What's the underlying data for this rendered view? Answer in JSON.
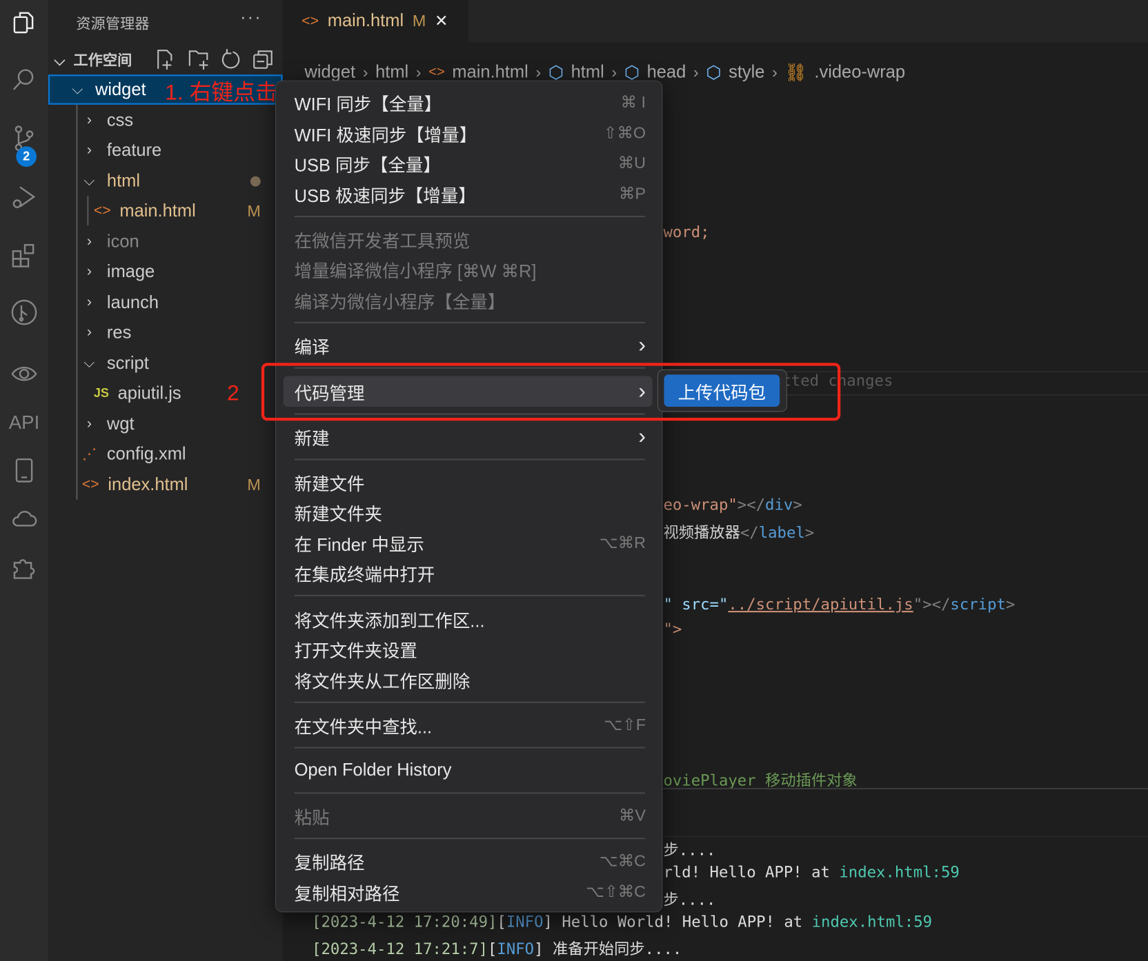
{
  "activity_bar": {
    "scm_badge": "2",
    "api_label": "API"
  },
  "sidebar": {
    "title": "资源管理器",
    "more": "···",
    "workspace": "工作空间",
    "tree": [
      {
        "label": "widget",
        "type": "folder",
        "open": true
      },
      {
        "label": "css",
        "type": "folder"
      },
      {
        "label": "feature",
        "type": "folder"
      },
      {
        "label": "html",
        "type": "folder",
        "open": true
      },
      {
        "label": "main.html",
        "type": "html",
        "status": "M"
      },
      {
        "label": "icon",
        "type": "folder"
      },
      {
        "label": "image",
        "type": "folder"
      },
      {
        "label": "launch",
        "type": "folder"
      },
      {
        "label": "res",
        "type": "folder"
      },
      {
        "label": "script",
        "type": "folder",
        "open": true
      },
      {
        "label": "apiutil.js",
        "type": "js"
      },
      {
        "label": "wgt",
        "type": "folder"
      },
      {
        "label": "config.xml",
        "type": "xml"
      },
      {
        "label": "index.html",
        "type": "html",
        "status": "M"
      }
    ],
    "js_icon": "JS"
  },
  "annotations": {
    "step1": "1. 右键点击",
    "step2": "2"
  },
  "tab": {
    "label": "main.html",
    "status": "M",
    "close": "✕"
  },
  "breadcrumb": [
    "widget",
    "html",
    "main.html",
    "html",
    "head",
    "style",
    ".video-wrap"
  ],
  "menu": {
    "items": [
      {
        "label": "WIFI 同步【全量】",
        "shortcut": "⌘ I"
      },
      {
        "label": "WIFI 极速同步【增量】",
        "shortcut": "⇧⌘O"
      },
      {
        "label": "USB 同步【全量】",
        "shortcut": "⌘U"
      },
      {
        "label": "USB 极速同步【增量】",
        "shortcut": "⌘P"
      },
      {
        "label": "在微信开发者工具预览",
        "shortcut": "",
        "disabled": true
      },
      {
        "label": "增量编译微信小程序 [⌘W ⌘R]",
        "shortcut": "",
        "disabled": true
      },
      {
        "label": "编译为微信小程序【全量】",
        "shortcut": "",
        "disabled": true
      },
      {
        "label": "编译",
        "shortcut": "›"
      },
      {
        "label": "代码管理",
        "shortcut": "›"
      },
      {
        "label": "新建",
        "shortcut": "›"
      },
      {
        "label": "新建文件",
        "shortcut": ""
      },
      {
        "label": "新建文件夹",
        "shortcut": ""
      },
      {
        "label": "在 Finder 中显示",
        "shortcut": "⌥⌘R"
      },
      {
        "label": "在集成终端中打开",
        "shortcut": ""
      },
      {
        "label": "将文件夹添加到工作区...",
        "shortcut": ""
      },
      {
        "label": "打开文件夹设置",
        "shortcut": ""
      },
      {
        "label": "将文件夹从工作区删除",
        "shortcut": ""
      },
      {
        "label": "在文件夹中查找...",
        "shortcut": "⌥⇧F"
      },
      {
        "label": "Open Folder History",
        "shortcut": ""
      },
      {
        "label": "粘贴",
        "shortcut": "⌘V",
        "disabled": true
      },
      {
        "label": "复制路径",
        "shortcut": "⌥⌘C"
      },
      {
        "label": "复制相对路径",
        "shortcut": "⌥⇧⌘C"
      }
    ],
    "submenu": {
      "upload": "上传代码包"
    }
  },
  "editor": {
    "l1": "word;",
    "l2": "tted changes",
    "l3a": "eo-wrap\"",
    "l3b": "></",
    "l3c": "div",
    "l3d": ">",
    "l4a": "视频播放器",
    "l4b": "</",
    "l4c": "label",
    "l4d": ">",
    "l5a": "\" src=\"",
    "l5b": "../script/apiutil.js",
    "l5c": "\"></",
    "l5d": "script",
    "l5e": ">",
    "l6": "\">",
    "l7": "oviePlayer 移动插件对象"
  },
  "terminal": {
    "lines": [
      {
        "pre": "",
        "text": "步...."
      },
      {
        "pre": "",
        "text": "rld! Hello APP! at ",
        "link": "index.html:59"
      },
      {
        "pre": "",
        "text": "步...."
      },
      {
        "time": "[2023-4-12 17:20:49]",
        "level": "INFO",
        "text": " Hello World! Hello APP! at ",
        "link": "index.html:59"
      },
      {
        "time": "[2023-4-12 17:21:7]",
        "level": "INFO",
        "text": " 准备开始同步...."
      }
    ]
  },
  "colors": {
    "accent": "#0a78d4",
    "upload": "#1f6bc4",
    "annotation": "#f02418"
  }
}
